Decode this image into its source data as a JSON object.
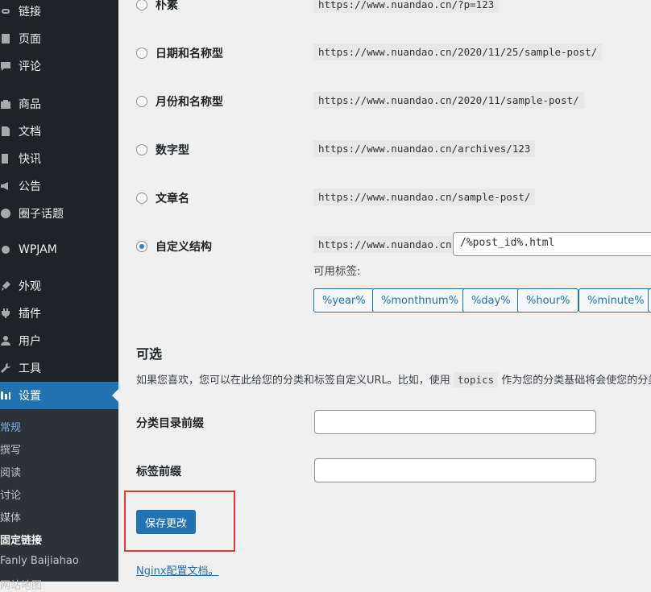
{
  "sidebar": {
    "items": [
      {
        "label": "链接",
        "icon": "link-icon"
      },
      {
        "label": "页面",
        "icon": "page-icon"
      },
      {
        "label": "评论",
        "icon": "comment-icon"
      },
      {
        "label": "商品",
        "icon": "shop-icon"
      },
      {
        "label": "文档",
        "icon": "doc-icon"
      },
      {
        "label": "快讯",
        "icon": "flash-icon"
      },
      {
        "label": "公告",
        "icon": "megaphone-icon"
      },
      {
        "label": "圈子话题",
        "icon": "group-icon"
      },
      {
        "label": "WPJAM",
        "icon": "wpjam-icon"
      },
      {
        "label": "外观",
        "icon": "brush-icon"
      },
      {
        "label": "插件",
        "icon": "plugin-icon"
      },
      {
        "label": "用户",
        "icon": "user-icon"
      },
      {
        "label": "工具",
        "icon": "wrench-icon"
      },
      {
        "label": "设置",
        "icon": "settings-icon"
      }
    ],
    "submenu": [
      "常规",
      "撰写",
      "阅读",
      "讨论",
      "媒体",
      "固定链接",
      "Fanly Baijiahao",
      "网站地图"
    ]
  },
  "permalink_options": [
    {
      "label": "朴素",
      "example": "https://www.nuandao.cn/?p=123",
      "checked": false
    },
    {
      "label": "日期和名称型",
      "example": "https://www.nuandao.cn/2020/11/25/sample-post/",
      "checked": false
    },
    {
      "label": "月份和名称型",
      "example": "https://www.nuandao.cn/2020/11/sample-post/",
      "checked": false
    },
    {
      "label": "数字型",
      "example": "https://www.nuandao.cn/archives/123",
      "checked": false
    },
    {
      "label": "文章名",
      "example": "https://www.nuandao.cn/sample-post/",
      "checked": false
    },
    {
      "label": "自定义结构",
      "example": "https://www.nuandao.cn",
      "checked": true
    }
  ],
  "custom_structure": {
    "value": "/%post_id%.html",
    "available_tags_label": "可用标签:",
    "tags": [
      "%year%",
      "%monthnum%",
      "%day%",
      "%hour%",
      "%minute%",
      "%"
    ]
  },
  "optional": {
    "title": "可选",
    "desc_before": "如果您喜欢，您可以在此给您的分类和标签自定义URL。比如，使用",
    "desc_code": "topics",
    "desc_after": "作为您的分类基础将会使您的分类",
    "category_base_label": "分类目录前缀",
    "category_base_value": "",
    "tag_base_label": "标签前缀",
    "tag_base_value": ""
  },
  "save_button": "保存更改",
  "footer": {
    "link_text": "Nginx配置文档",
    "period": "。"
  },
  "colors": {
    "accent": "#2271b1",
    "sidebar_bg": "#1d2327",
    "highlight": "#e53935"
  }
}
